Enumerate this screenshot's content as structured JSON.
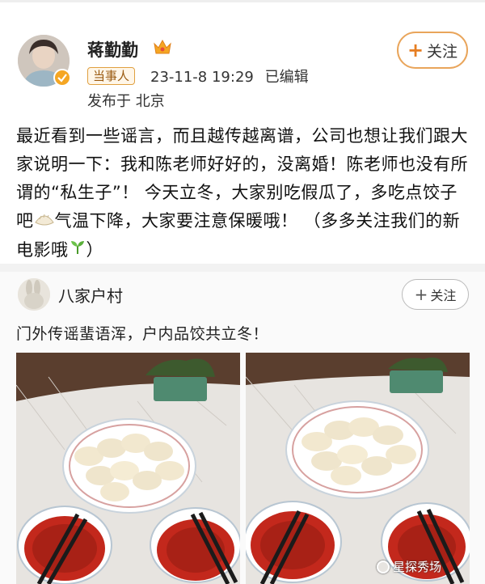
{
  "post1": {
    "user_name": "蒋勤勤",
    "tag": "当事人",
    "timestamp": "23-11-8 19:29",
    "edited": "已编辑",
    "location": "发布于 北京",
    "follow_label": "关注",
    "text_part1": "最近看到一些谣言，而且越传越离谱，公司也想让我们跟大家说明一下：我和陈老师好好的，没离婚！陈老师也没有所谓的“私生子”！ 今天立冬，大家别吃假瓜了，多吃点饺子吧",
    "text_part2": "气温下降，大家要注意保暖哦！ （多多关注我们的新电影哦",
    "text_part3": "）",
    "icons": {
      "crown": "crown-icon",
      "verified": "verified-badge-icon",
      "dumpling": "dumpling-emoji-icon",
      "sprout": "sprout-emoji-icon"
    }
  },
  "post2": {
    "user_name": "八家户村",
    "follow_label": "关注",
    "text": "门外传谣蜚语浑，户内品饺共立冬！"
  },
  "watermark": "星探秀场",
  "colors": {
    "follow_border": "#e9a55b",
    "tag_border": "#e0a040",
    "divider": "#f2f2f2"
  }
}
